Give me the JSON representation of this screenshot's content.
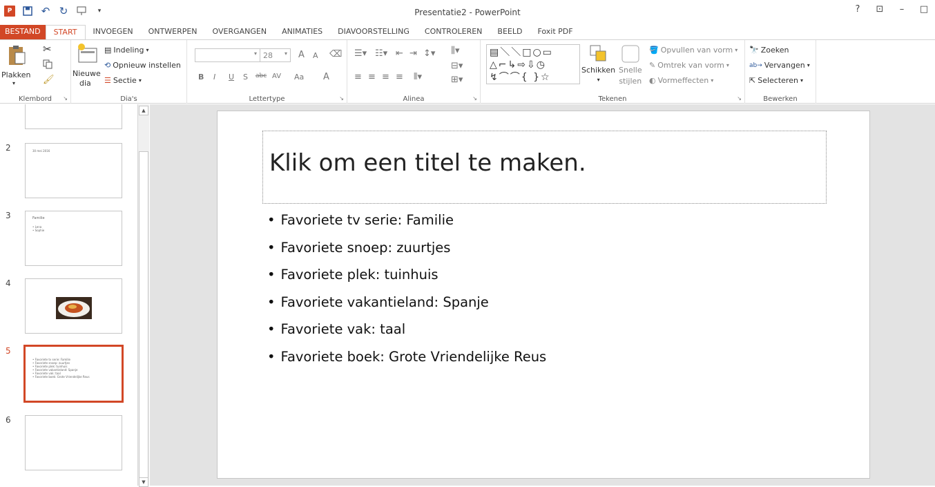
{
  "window": {
    "title": "Presentatie2 - PowerPoint",
    "controls": [
      "?",
      "⊡",
      "–",
      "□"
    ]
  },
  "qat": {
    "icons": [
      "powerpoint-logo",
      "save-icon",
      "undo-icon",
      "redo-icon",
      "start-from-beginning-icon",
      "customize-qat-icon"
    ]
  },
  "tabs": {
    "file": "BESTAND",
    "items": [
      "START",
      "INVOEGEN",
      "ONTWERPEN",
      "OVERGANGEN",
      "ANIMATIES",
      "DIAVOORSTELLING",
      "CONTROLEREN",
      "BEELD",
      "Foxit PDF"
    ],
    "active": "START"
  },
  "ribbon": {
    "klembord": {
      "label": "Klembord",
      "paste": "Plakken"
    },
    "dias": {
      "label": "Dia's",
      "new_slide_1": "Nieuwe",
      "new_slide_2": "dia",
      "layout": "Indeling",
      "reset": "Opnieuw instellen",
      "section": "Sectie"
    },
    "lettertype": {
      "label": "Lettertype",
      "font_size": "28",
      "bold": "B",
      "italic": "I",
      "underline": "U",
      "shadow": "S",
      "strike": "abc",
      "spacing": "AV",
      "case": "Aa",
      "color": "A",
      "grow": "A",
      "shrink": "A"
    },
    "alinea": {
      "label": "Alinea"
    },
    "tekenen": {
      "label": "Tekenen",
      "arrange": "Schikken",
      "quick_1": "Snelle",
      "quick_2": "stijlen",
      "fill": "Opvullen van vorm",
      "outline": "Omtrek van vorm",
      "effects": "Vormeffecten"
    },
    "bewerken": {
      "label": "Bewerken",
      "find": "Zoeken",
      "replace": "Vervangen",
      "select": "Selecteren"
    }
  },
  "thumbnails": [
    {
      "num": "",
      "lines": []
    },
    {
      "num": "2",
      "lines": [
        "30 mei 2016"
      ]
    },
    {
      "num": "3",
      "lines": [
        "Familie",
        "• Lena",
        "• Sophie"
      ]
    },
    {
      "num": "4",
      "lines": []
    },
    {
      "num": "5",
      "lines": [
        "• Favoriete tv serie: Familie",
        "• Favoriete snoep: zuurtjes",
        "• Favoriete plek: tuinhuis",
        "• Favoriete vakantieland: Spanje",
        "• Favoriete vak: taal",
        "• Favoriete boek: Grote Vriendelijke Reus"
      ]
    },
    {
      "num": "6",
      "lines": []
    }
  ],
  "slide": {
    "title_placeholder": "Klik om een titel te maken.",
    "bullets": [
      "Favoriete tv serie: Familie",
      "Favoriete snoep: zuurtjes",
      "Favoriete plek: tuinhuis",
      "Favoriete vakantieland: Spanje",
      "Favoriete vak: taal",
      "Favoriete boek: Grote Vriendelijke Reus"
    ]
  },
  "colors": {
    "accent": "#d24726",
    "editor_bg": "#e3e3e3"
  }
}
